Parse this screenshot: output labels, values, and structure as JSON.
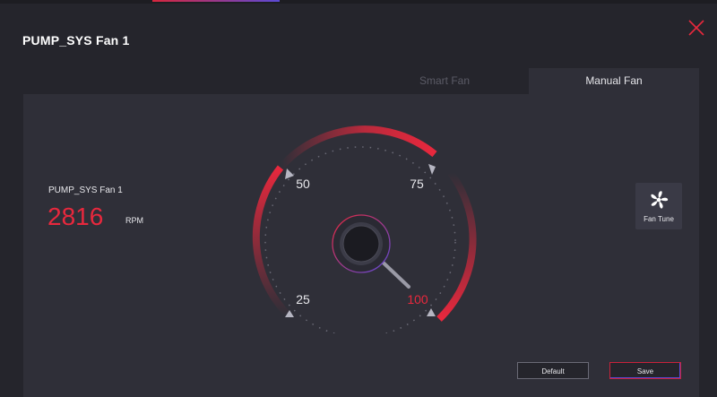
{
  "window": {
    "title": "PUMP_SYS Fan 1"
  },
  "tabs": [
    {
      "label": "Smart Fan",
      "active": false
    },
    {
      "label": "Manual Fan",
      "active": true
    }
  ],
  "fan": {
    "name": "PUMP_SYS Fan 1",
    "rpm": "2816",
    "rpm_unit": "RPM"
  },
  "gauge": {
    "tick_labels": [
      "25",
      "50",
      "75",
      "100"
    ],
    "highlighted_label": "100",
    "value_percent": 100
  },
  "fan_tune": {
    "label": "Fan Tune",
    "icon": "fan-icon"
  },
  "buttons": {
    "default_label": "Default",
    "save_label": "Save"
  },
  "colors": {
    "accent": "#e8283d",
    "secondary_accent": "#5b4ad6",
    "background": "#25252c",
    "panel": "#2f2f38"
  }
}
